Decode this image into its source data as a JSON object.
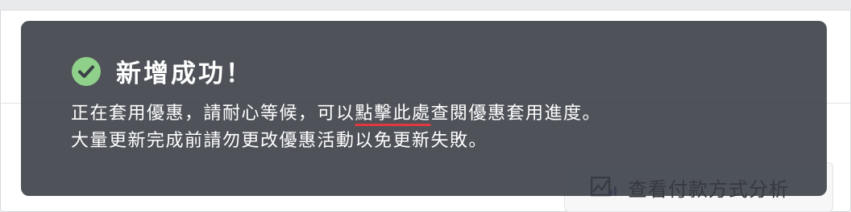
{
  "toast": {
    "title": "新增成功！",
    "line1_before": "正在套用優惠，請耐心等候，可以",
    "link_text": "點擊此處",
    "line1_after": "查閱優惠套用進度。",
    "line2": "大量更新完成前請勿更改優惠活動以免更新失敗。",
    "check_icon": "check-circle-icon",
    "check_color": "#8fd18a",
    "link_underline_color": "#e0383e"
  },
  "background": {
    "analysis_button_label": "查看付款方式分析",
    "analysis_icon": "chart-icon"
  }
}
